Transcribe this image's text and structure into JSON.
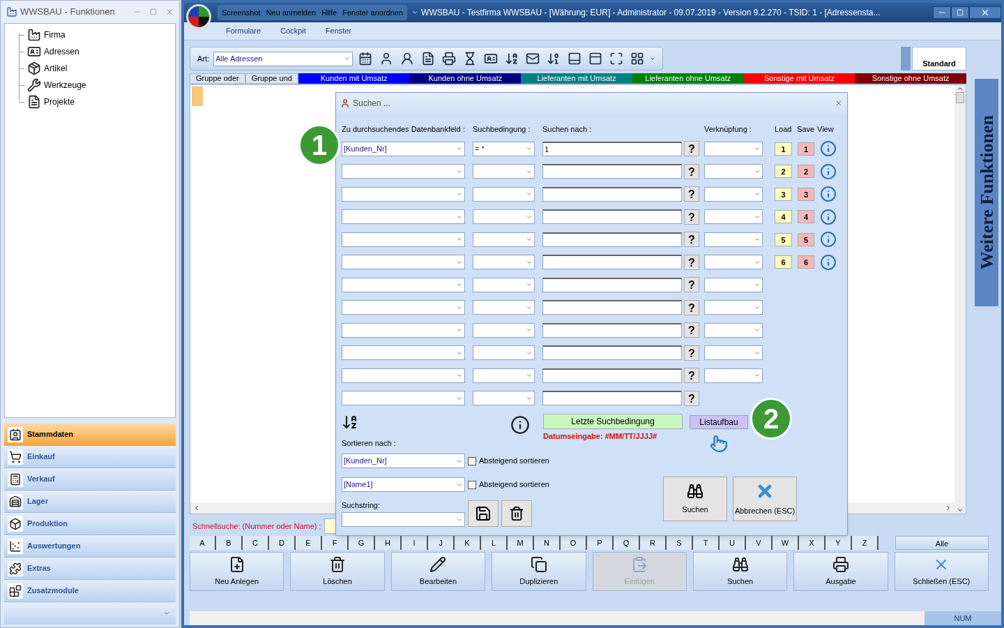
{
  "left_window": {
    "title": "WWSBAU - Funktionen",
    "tree": [
      {
        "label": "Firma"
      },
      {
        "label": "Adressen"
      },
      {
        "label": "Artikel"
      },
      {
        "label": "Werkzeuge"
      },
      {
        "label": "Projekte"
      }
    ],
    "nav": [
      {
        "label": "Stammdaten",
        "selected": true
      },
      {
        "label": "Einkauf",
        "selected": false
      },
      {
        "label": "Verkauf",
        "selected": false
      },
      {
        "label": "Lager",
        "selected": false
      },
      {
        "label": "Produktion",
        "selected": false
      },
      {
        "label": "Auswertungen",
        "selected": false
      },
      {
        "label": "Extras",
        "selected": false
      },
      {
        "label": "Zusatzmodule",
        "selected": false
      }
    ]
  },
  "main_window": {
    "quick_access": [
      "Screenshot",
      "Neu anmelden",
      "Hilfe",
      "Fenster anordnen"
    ],
    "title": "WWSBAU - Testfirma WWSBAU - [Währung: EUR] - Administrator - 09.07.2019 - Version 9.2.270 - TSID: 1  - [Adressensta...",
    "menu": [
      "Formulare",
      "Cockpit",
      "Fenster"
    ],
    "toolbar": {
      "art_label": "Art:",
      "art_value": "Alle Adressen",
      "layout_button": "Standard"
    },
    "group_tabs": [
      {
        "label": "Gruppe oder",
        "kind": "button"
      },
      {
        "label": "Gruppe und",
        "kind": "button"
      },
      {
        "label": "Kunden mit Umsatz",
        "kind": "filter",
        "color": "#0000ff"
      },
      {
        "label": "Kunden ohne Umsatz",
        "kind": "filter",
        "color": "#000080"
      },
      {
        "label": "Lieferanten mit Umsatz",
        "kind": "filter",
        "color": "#008080"
      },
      {
        "label": "Lieferanten ohne Umsatz",
        "kind": "filter",
        "color": "#008000"
      },
      {
        "label": "Sonstige mit Umsatz",
        "kind": "filter",
        "color": "#ff0000"
      },
      {
        "label": "Sonstige ohne Umsatz",
        "kind": "filter",
        "color": "#800000"
      }
    ],
    "side_tab": "Weitere Funktionen",
    "quick_search_label": "Schnellsuche: (Nummer oder Name) :",
    "letters": [
      "A",
      "B",
      "C",
      "D",
      "E",
      "F",
      "G",
      "H",
      "I",
      "J",
      "K",
      "L",
      "M",
      "N",
      "O",
      "P",
      "Q",
      "R",
      "S",
      "T",
      "U",
      "V",
      "W",
      "X",
      "Y",
      "Z"
    ],
    "all_button": "Alle",
    "actions": [
      {
        "label": "Neu Anlegen",
        "disabled": false
      },
      {
        "label": "Löschen",
        "disabled": false
      },
      {
        "label": "Bearbeiten",
        "disabled": false
      },
      {
        "label": "Duplizieren",
        "disabled": false
      },
      {
        "label": "Einfügen",
        "disabled": true
      },
      {
        "label": "Suchen",
        "disabled": false
      },
      {
        "label": "Ausgabe",
        "disabled": false
      },
      {
        "label": "Schließen (ESC)",
        "disabled": false
      }
    ],
    "status": "NUM"
  },
  "dialog": {
    "title": "Suchen ...",
    "headers": {
      "field": "Zu durchsuchendes Datenbankfeld :",
      "condition": "Suchbedingung :",
      "value": "Suchen nach :",
      "link": "Verknüpfung :",
      "load": "Load",
      "save": "Save",
      "view": "View"
    },
    "rows": [
      {
        "field": "[Kunden_Nr]",
        "condition": "= *",
        "value": "1",
        "link": true
      },
      {
        "link": true
      },
      {
        "link": true
      },
      {
        "link": true
      },
      {
        "link": true
      },
      {
        "link": true
      },
      {
        "link": true
      },
      {
        "link": true
      },
      {
        "link": true
      },
      {
        "link": true
      },
      {
        "link": true
      },
      {
        "link": false
      }
    ],
    "help_mark": "?",
    "load": [
      "1",
      "2",
      "3",
      "4",
      "5",
      "6"
    ],
    "save": [
      "1",
      "2",
      "3",
      "4",
      "5",
      "6"
    ],
    "last_condition": "Letzte Suchbedingung",
    "date_hint": "Datumseingabe: #MM/TT/JJJJ#",
    "list_button": "Listaufbau",
    "sort_label": "Sortieren nach :",
    "sorts": [
      {
        "field": "[Kunden_Nr]",
        "label": "Absteigend sortieren",
        "checked": false
      },
      {
        "field": "[Name1]",
        "label": "Absteigend sortieren",
        "checked": false
      }
    ],
    "suchstring_label": "Suchstring:",
    "search_button": "Suchen",
    "cancel_button": "Abbrechen (ESC)"
  },
  "callouts": [
    "1",
    "2"
  ]
}
